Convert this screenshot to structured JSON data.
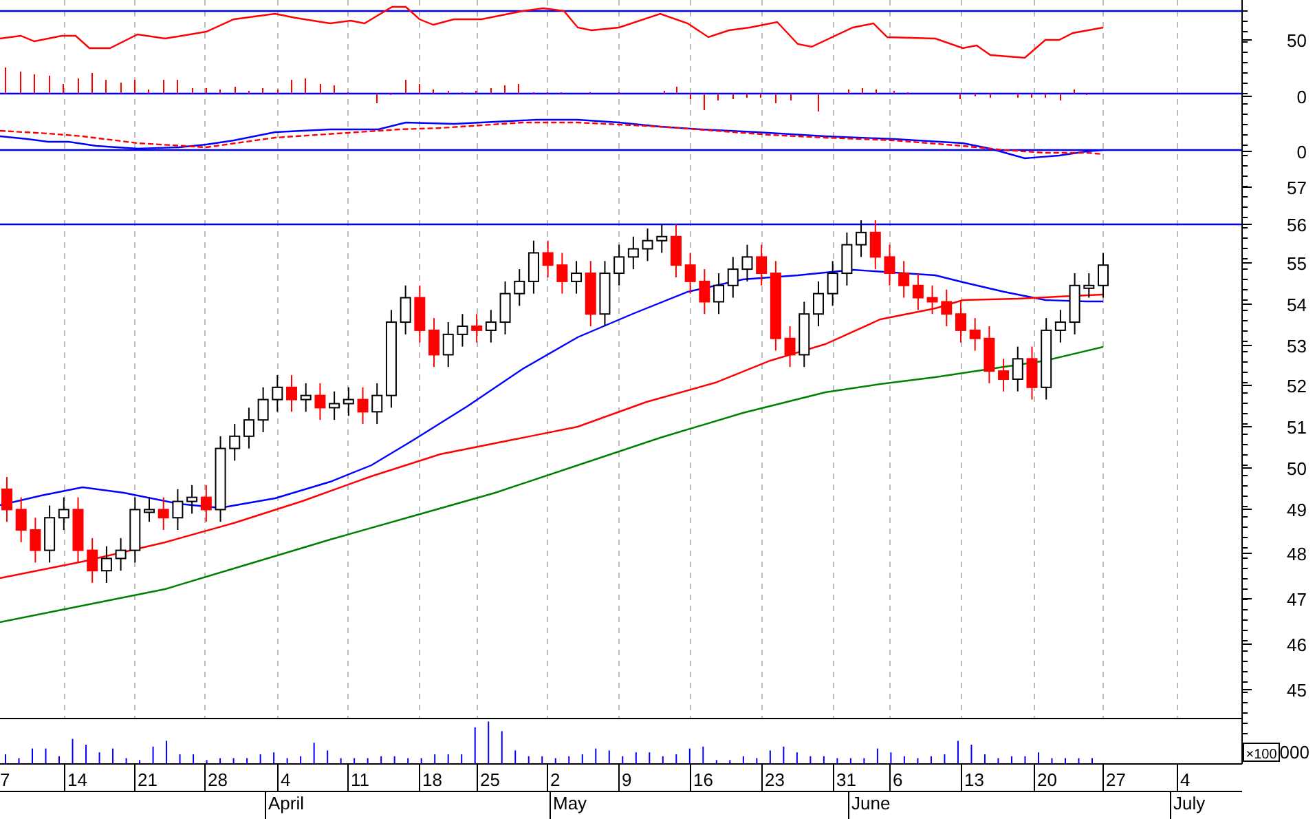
{
  "price_axis": {
    "labels": [
      "50",
      "0",
      "0",
      "57",
      "56",
      "55",
      "54",
      "53",
      "52",
      "51",
      "50",
      "49",
      "48",
      "47",
      "46",
      "45"
    ]
  },
  "volume_axis": {
    "multiplier": "×100",
    "label": "000"
  },
  "date_axis": {
    "days": [
      "7",
      "14",
      "21",
      "28",
      "4",
      "11",
      "18",
      "25",
      "2",
      "9",
      "16",
      "23",
      "31",
      "6",
      "13",
      "20",
      "27",
      "4"
    ],
    "months": [
      "April",
      "May",
      "June",
      "July"
    ]
  }
}
